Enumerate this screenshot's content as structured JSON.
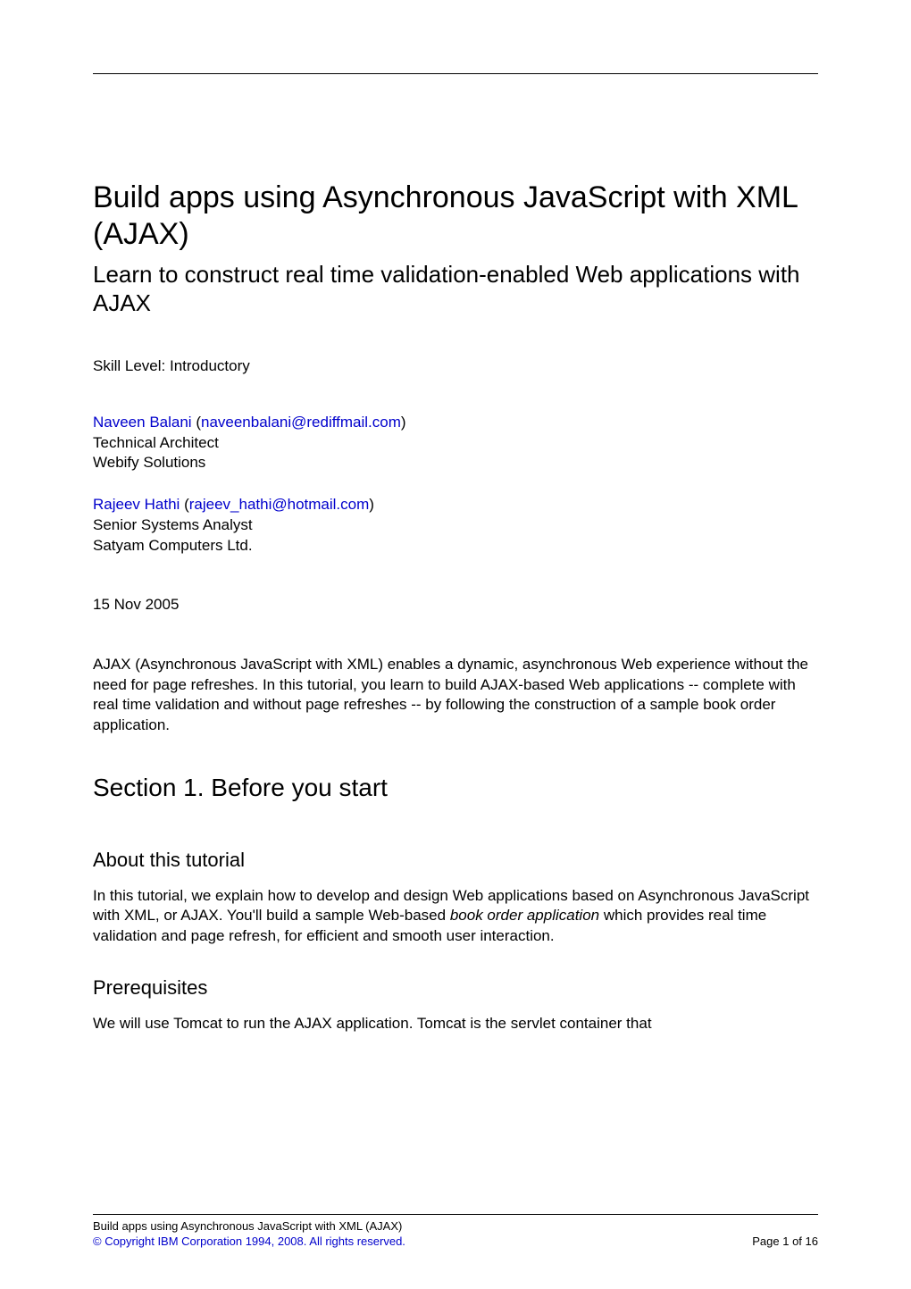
{
  "header": {
    "title": "Build apps using Asynchronous JavaScript with XML (AJAX)",
    "subtitle": "Learn to construct real time validation-enabled Web applications with AJAX",
    "skill_level_label": "Skill Level: Introductory"
  },
  "authors": [
    {
      "name": "Naveen Balani",
      "email": "naveenbalani@rediffmail.com",
      "role": "Technical Architect",
      "org": "Webify Solutions"
    },
    {
      "name": "Rajeev Hathi",
      "email": "rajeev_hathi@hotmail.com",
      "role": "Senior Systems Analyst",
      "org": "Satyam Computers Ltd."
    }
  ],
  "pub_date": "15 Nov 2005",
  "abstract": "AJAX (Asynchronous JavaScript with XML) enables a dynamic, asynchronous Web experience without the need for page refreshes. In this tutorial, you learn to build AJAX-based Web applications -- complete with real time validation and without page refreshes -- by following the construction of a sample book order application.",
  "section1": {
    "heading": "Section 1. Before you start",
    "about": {
      "heading": "About this tutorial",
      "para_pre": "In this tutorial, we explain how to develop and design Web applications based on Asynchronous JavaScript with XML, or AJAX. You'll build a sample Web-based ",
      "para_italic": "book order application",
      "para_post": " which provides real time validation and page refresh, for efficient and smooth user interaction."
    },
    "prereq": {
      "heading": "Prerequisites",
      "para": "We will use Tomcat to run the AJAX application. Tomcat is the servlet container that"
    }
  },
  "footer": {
    "left_line1": "Build apps using Asynchronous JavaScript with XML (AJAX)",
    "left_line2": "© Copyright IBM Corporation 1994, 2008. All rights reserved.",
    "right": "Page 1 of 16"
  }
}
